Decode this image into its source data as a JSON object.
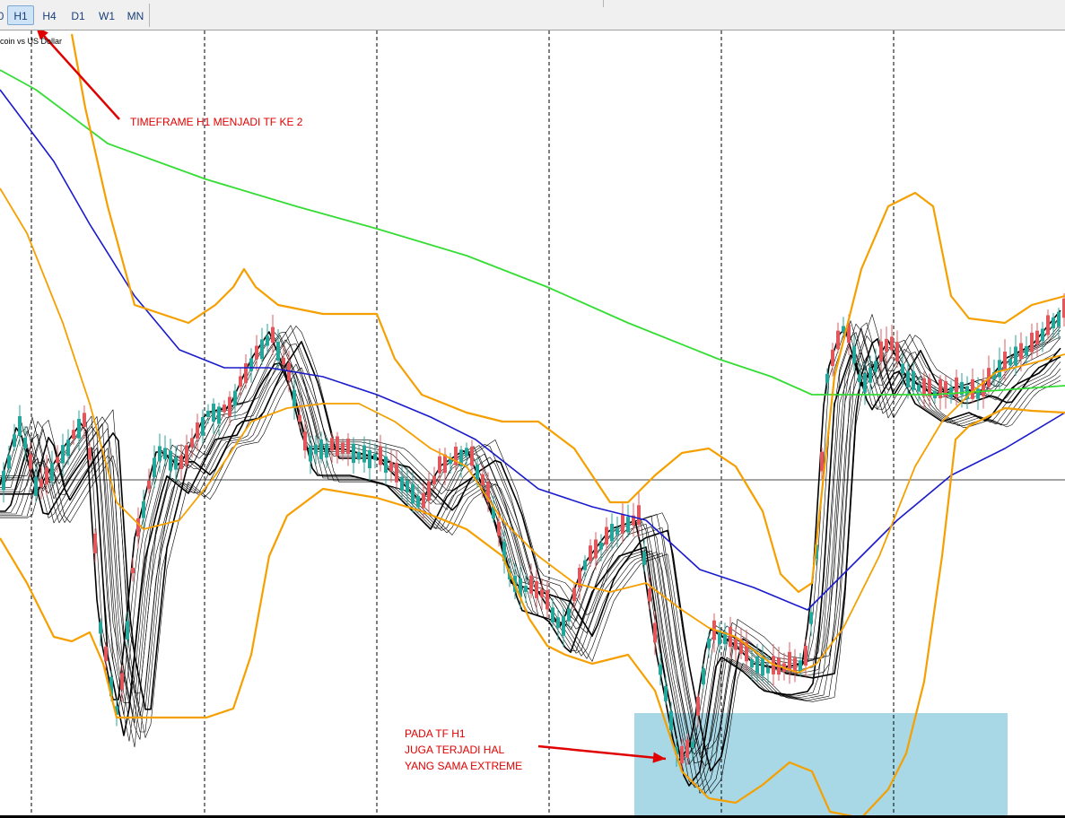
{
  "toolbar": {
    "partial_left": "0",
    "timeframes": [
      "H1",
      "H4",
      "D1",
      "W1",
      "MN"
    ],
    "active": "H1"
  },
  "chart": {
    "symbol": "coin vs US Dollar",
    "colors": {
      "bull_candle": "#26a69a",
      "bear_candle": "#e0585c",
      "ma_slow": "#33dd33",
      "ma_mid": "#1a1acc",
      "bands": "#f5a000",
      "ribbon": "#000000",
      "zone": "#a8d8e6",
      "annotation": "#e00000"
    }
  },
  "annotations": {
    "top": "TIMEFRAME H1 MENJADI TF KE 2",
    "bottom_lines": [
      "PADA TF H1",
      "JUGA TERJADI HAL",
      "YANG SAMA EXTREME"
    ]
  }
}
